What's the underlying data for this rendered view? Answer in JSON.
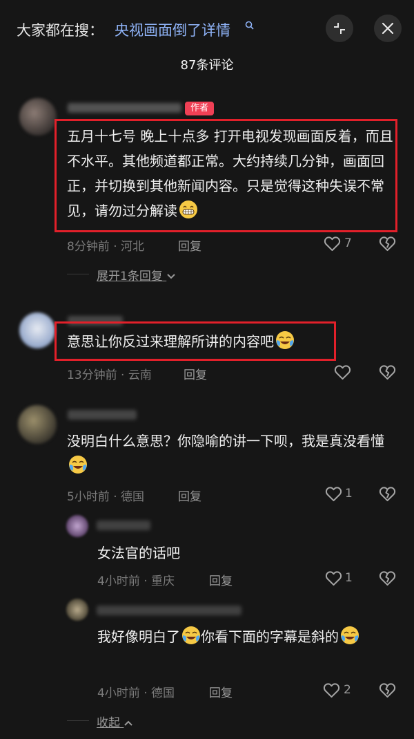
{
  "header": {
    "search_prefix": "大家都在搜：",
    "search_link": "央视画面倒了详情",
    "comment_count": "87条评论"
  },
  "comments": [
    {
      "badge": "作者",
      "text": "五月十七号 晚上十点多 打开电视发现画面反着，而且不水平。其他频道都正常。大约持续几分钟，画面回正，并切换到其他新闻内容。只是觉得这种失误不常见，请勿过分解读",
      "emoji": "grinning-face",
      "meta": "8分钟前 · 河北",
      "reply_label": "回复",
      "likes": "7",
      "expand_label": "展开1条回复"
    },
    {
      "text": "意思让你反过来理解所讲的内容吧",
      "emoji": "rofl-face",
      "meta": "13分钟前 · 云南",
      "reply_label": "回复"
    },
    {
      "text": "没明白什么意思？你隐喻的讲一下呗，我是真没看懂",
      "emoji": "rofl-face",
      "meta": "5小时前 · 德国",
      "reply_label": "回复",
      "likes": "1",
      "replies": [
        {
          "text": "女法官的话吧",
          "meta": "4小时前 · 重庆",
          "reply_label": "回复",
          "likes": "1"
        },
        {
          "text_before": "我好像明白了",
          "text_after": "你看下面的字幕是斜的",
          "emoji": "rofl-face",
          "meta": "4小时前 · 德国",
          "reply_label": "回复",
          "likes": "2"
        }
      ],
      "collapse_label": "收起"
    }
  ],
  "colors": {
    "background": "#161616",
    "author_badge": "#f04055",
    "search_link": "#8fb3f7",
    "annotation_box": "#e2202a"
  },
  "icons": [
    "search-icon",
    "collapse-icon",
    "close-icon",
    "heart-icon",
    "broken-heart-icon",
    "chevron-down-icon",
    "chevron-up-icon"
  ]
}
